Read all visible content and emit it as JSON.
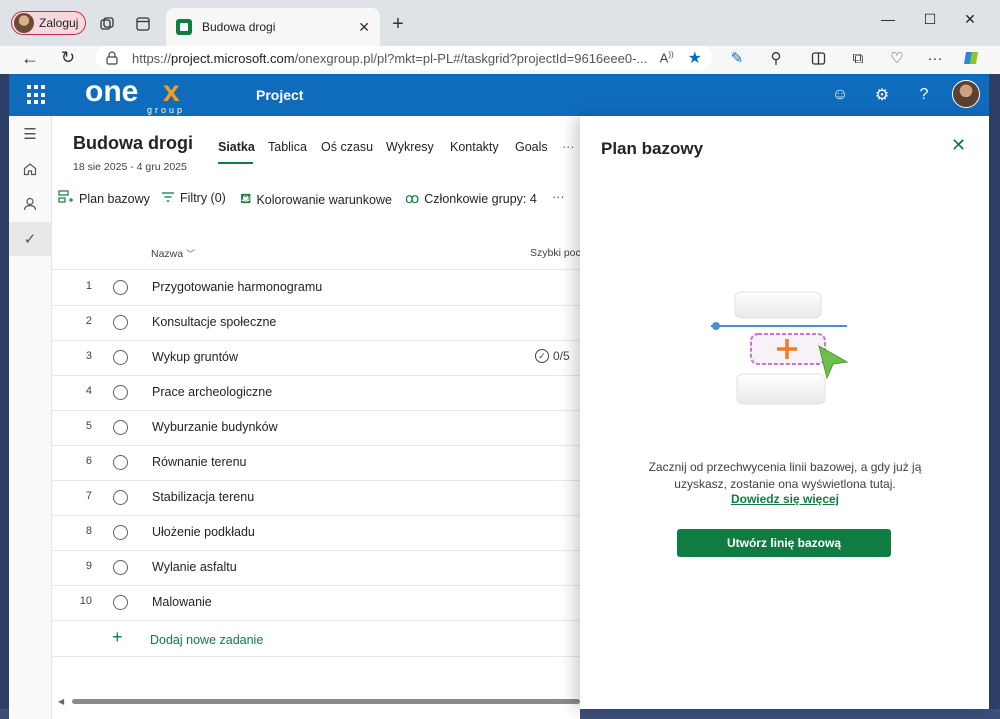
{
  "browser": {
    "profile_label": "Zaloguj",
    "tab_title": "Budowa drogi",
    "url_prefix": "https://",
    "url_host": "project.microsoft.com",
    "url_path": "/onexgroup.pl/pl?mkt=pl-PL#/taskgrid?projectId=9616eee0-...",
    "icons": [
      "workspaces-icon",
      "tab-actions-icon",
      "close-tab-icon",
      "new-tab-icon",
      "minimize-icon",
      "maximize-icon",
      "close-window-icon",
      "back-icon",
      "refresh-icon",
      "lock-icon",
      "read-aloud-icon",
      "favorite-star-icon",
      "pen-icon",
      "extensions-icon",
      "split-screen-icon",
      "collections-icon",
      "browser-essentials-icon",
      "more-icon",
      "copilot-icon"
    ]
  },
  "app": {
    "logo_text": "onex",
    "logo_sub": "group",
    "product": "Project",
    "brand_color": "#0f6cbd",
    "accent_color": "#107c41"
  },
  "project": {
    "title": "Budowa drogi",
    "dates": "18 sie 2025 - 4 gru 2025",
    "tabs": [
      "Siatka",
      "Tablica",
      "Oś czasu",
      "Wykresy",
      "Kontakty",
      "Goals"
    ],
    "more": "···"
  },
  "toolbar": {
    "baseline": "Plan bazowy",
    "filters": "Filtry (0)",
    "conditional": "Kolorowanie warunkowe",
    "members": "Członkowie grupy: 4",
    "more": "···"
  },
  "grid": {
    "col_name": "Nazwa",
    "col_quick": "Szybki poc",
    "rows": [
      {
        "num": "1",
        "name": "Przygotowanie harmonogramu",
        "checklist": ""
      },
      {
        "num": "2",
        "name": "Konsultacje społeczne",
        "checklist": ""
      },
      {
        "num": "3",
        "name": "Wykup gruntów",
        "checklist": "0/5"
      },
      {
        "num": "4",
        "name": "Prace archeologiczne",
        "checklist": ""
      },
      {
        "num": "5",
        "name": "Wyburzanie budynków",
        "checklist": ""
      },
      {
        "num": "6",
        "name": "Równanie terenu",
        "checklist": ""
      },
      {
        "num": "7",
        "name": "Stabilizacja terenu",
        "checklist": ""
      },
      {
        "num": "8",
        "name": "Ułożenie podkładu",
        "checklist": ""
      },
      {
        "num": "9",
        "name": "Wylanie asfaltu",
        "checklist": ""
      },
      {
        "num": "10",
        "name": "Malowanie",
        "checklist": ""
      }
    ],
    "add_task": "Dodaj nowe zadanie"
  },
  "panel": {
    "title": "Plan bazowy",
    "message": "Zacznij od przechwycenia linii bazowej, a gdy już ją uzyskasz, zostanie ona wyświetlona tutaj.",
    "link": "Dowiedz się więcej",
    "button": "Utwórz linię bazową"
  }
}
